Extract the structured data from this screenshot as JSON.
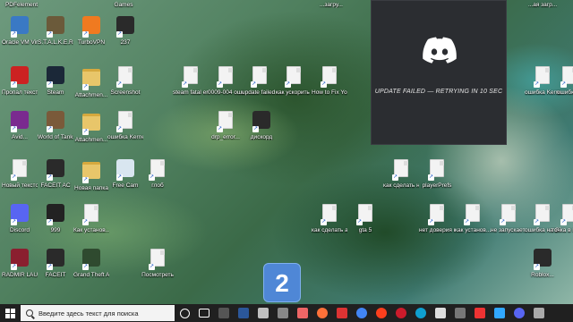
{
  "desktop": {
    "top_labels": {
      "left": "PDFelement",
      "games": "Games",
      "r1": "...загру...",
      "r2": "...ая загр..."
    },
    "icons": [
      {
        "label": "Oracle VM VirtualBox",
        "color": "#3a79c4",
        "kind": "app"
      },
      {
        "label": "S.T.A.L.K.E.R. Call of Prip...",
        "color": "#6b5a3a",
        "kind": "app"
      },
      {
        "label": "TurboVPN",
        "color": "#f07a20",
        "kind": "app"
      },
      {
        "label": "237",
        "color": "#2a2a2a",
        "kind": "app"
      },
      {
        "label": "Пропал текстов...",
        "color": "#c22",
        "kind": "app"
      },
      {
        "label": "Steam",
        "color": "#1b2838",
        "kind": "app"
      },
      {
        "label": "Attachmen...",
        "color": "#e8c66a",
        "kind": "folder"
      },
      {
        "label": "Screenshot",
        "color": "#eee",
        "kind": "doc"
      },
      {
        "label": "steam fatal error appli...",
        "kind": "doc"
      },
      {
        "label": "0009-004 ошибка ст...",
        "kind": "doc"
      },
      {
        "label": "update failed discord",
        "kind": "doc"
      },
      {
        "label": "как ускорить интернет н...",
        "kind": "doc"
      },
      {
        "label": "How to Fix Your Backs...",
        "kind": "doc"
      },
      {
        "label": "Avid...",
        "color": "#7a2b8f",
        "kind": "app"
      },
      {
        "label": "World of Tanks Blitz",
        "color": "#7a5a3a",
        "kind": "app"
      },
      {
        "label": "Attachmen...",
        "color": "#e8c66a",
        "kind": "folder"
      },
      {
        "label": "ошибка Kernel Secu...",
        "kind": "doc"
      },
      {
        "label": "drp_error...",
        "kind": "doc"
      },
      {
        "label": "дискорд",
        "color": "#2a2a2a",
        "kind": "app"
      },
      {
        "label": "Новый текстов...",
        "kind": "doc"
      },
      {
        "label": "FACEIT AC",
        "color": "#2a2a2a",
        "kind": "app"
      },
      {
        "label": "Новая папка",
        "color": "#e8c66a",
        "kind": "folder"
      },
      {
        "label": "Free Cam",
        "color": "#d9e6f0",
        "kind": "app"
      },
      {
        "label": "глоб",
        "kind": "doc"
      },
      {
        "label": "как сделать невидимы...",
        "kind": "doc"
      },
      {
        "label": "playerPrefs",
        "kind": "doc"
      },
      {
        "label": "Discord",
        "color": "#5865f2",
        "kind": "app"
      },
      {
        "label": "999",
        "color": "#222",
        "kind": "app"
      },
      {
        "label": "Как установ...",
        "kind": "doc"
      },
      {
        "label": "как сделать анимиров...",
        "kind": "doc"
      },
      {
        "label": "gta 5",
        "kind": "doc"
      },
      {
        "label": "нет доверия к cab файлу",
        "kind": "doc"
      },
      {
        "label": "как установ...",
        "kind": "doc"
      },
      {
        "label": "не запускает...",
        "kind": "doc"
      },
      {
        "label": "ошибка на GTA...",
        "kind": "doc"
      },
      {
        "label": "точка в папке...",
        "kind": "doc"
      },
      {
        "label": "RADMIR LAUNCHER",
        "color": "#8a1f2f",
        "kind": "app"
      },
      {
        "label": "FACEIT",
        "color": "#2a2a2a",
        "kind": "app"
      },
      {
        "label": "Grand Theft Auto V",
        "color": "#2f4a2f",
        "kind": "app"
      },
      {
        "label": "Посмотреть",
        "kind": "doc"
      },
      {
        "label": "Roblox...",
        "color": "#2a2a2a",
        "kind": "app"
      },
      {
        "label": "ошибка Kernel Secu...",
        "kind": "doc"
      },
      {
        "label": "ошибка...",
        "kind": "doc"
      }
    ]
  },
  "discord_overlay": {
    "status": "UPDATE FAILED — RETRYING IN 10 SEC",
    "accent": "#ffffff",
    "background": "#2b2d31"
  },
  "desktop_badge": {
    "number": "2"
  },
  "taskbar": {
    "search_placeholder": "Введите здесь текст для поиска",
    "icons": [
      {
        "name": "cortana",
        "color": "#ffffff"
      },
      {
        "name": "task-view",
        "color": "#ffffff"
      },
      {
        "name": "calculator",
        "color": "#555"
      },
      {
        "name": "word",
        "color": "#2b579a"
      },
      {
        "name": "store",
        "color": "#c0c0c0"
      },
      {
        "name": "photos",
        "color": "#888"
      },
      {
        "name": "mail",
        "color": "#e66"
      },
      {
        "name": "firefox",
        "color": "#ff7139"
      },
      {
        "name": "media",
        "color": "#d33"
      },
      {
        "name": "chrome",
        "color": "#4285f4"
      },
      {
        "name": "yandex",
        "color": "#fc3f1d"
      },
      {
        "name": "opera",
        "color": "#cc1b2b"
      },
      {
        "name": "edge",
        "color": "#0fa0d0"
      },
      {
        "name": "pc",
        "color": "#ddd"
      },
      {
        "name": "app",
        "color": "#777"
      },
      {
        "name": "yandex-alt",
        "color": "#e33"
      },
      {
        "name": "photoshop",
        "color": "#31a8ff"
      },
      {
        "name": "discord",
        "color": "#5865f2"
      },
      {
        "name": "terminal",
        "color": "#aaa"
      }
    ]
  }
}
